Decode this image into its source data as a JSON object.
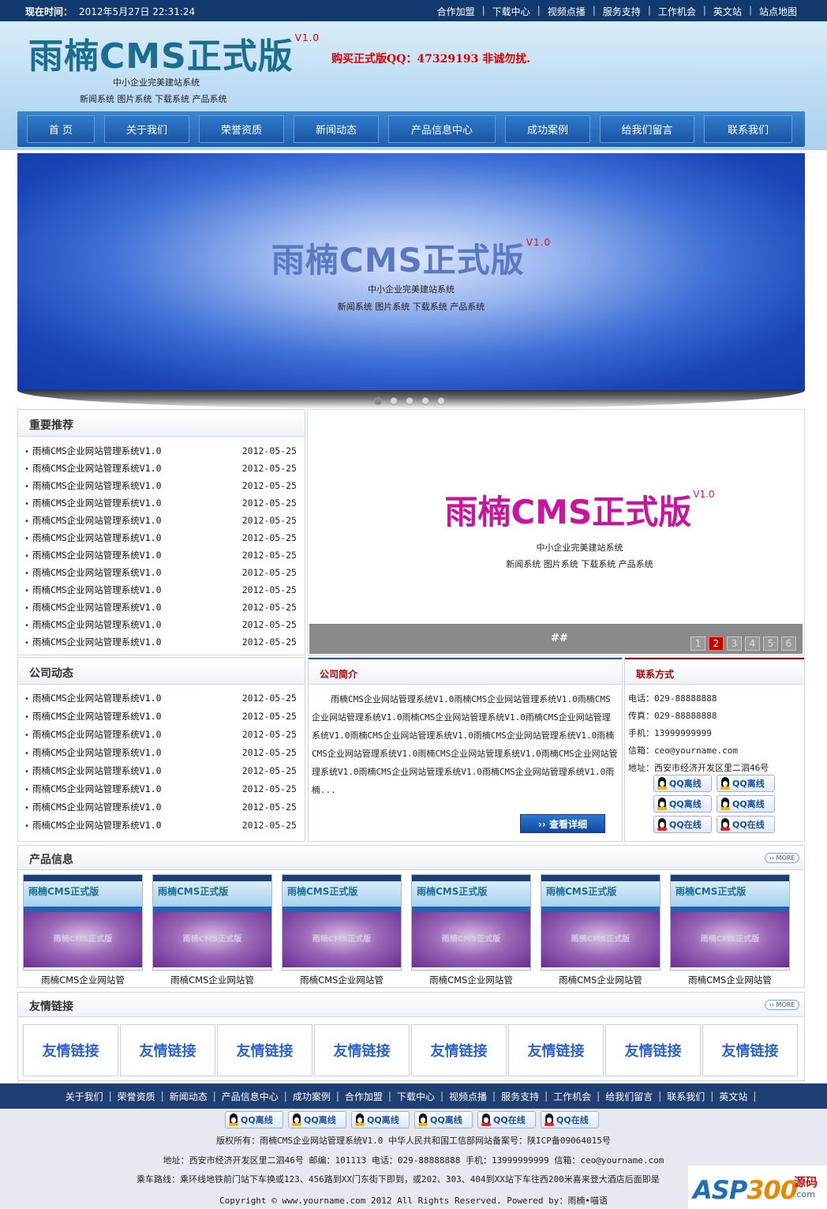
{
  "topbar": {
    "time_label": "现在时间：",
    "time_value": "2012年5月27日 22:31:24",
    "links": [
      "合作加盟",
      "下载中心",
      "视频点播",
      "服务支持",
      "工作机会",
      "英文站",
      "站点地图"
    ]
  },
  "header": {
    "logo_text": "雨楠CMS正式版",
    "logo_version": "V1.0",
    "subtitle1": "中小企业完美建站系统",
    "subtitle2": "新闻系统 图片系统 下载系统 产品系统",
    "buy_text": "购买正式版QQ：47329193 非诚勿扰."
  },
  "nav": {
    "items": [
      "首 页",
      "关于我们",
      "荣誉资质",
      "新闻动态",
      "产品信息中心",
      "成功案例",
      "给我们留言",
      "联系我们"
    ]
  },
  "banner": {
    "title": "雨楠CMS正式版",
    "version": "V1.0",
    "subtitle1": "中小企业完美建站系统",
    "subtitle2": "新闻系统 图片系统 下载系统 产品系统"
  },
  "recommend": {
    "title": "重要推荐",
    "items": [
      {
        "t": "雨楠CMS企业网站管理系统V1.0",
        "d": "2012-05-25"
      },
      {
        "t": "雨楠CMS企业网站管理系统V1.0",
        "d": "2012-05-25"
      },
      {
        "t": "雨楠CMS企业网站管理系统V1.0",
        "d": "2012-05-25"
      },
      {
        "t": "雨楠CMS企业网站管理系统V1.0",
        "d": "2012-05-25"
      },
      {
        "t": "雨楠CMS企业网站管理系统V1.0",
        "d": "2012-05-25"
      },
      {
        "t": "雨楠CMS企业网站管理系统V1.0",
        "d": "2012-05-25"
      },
      {
        "t": "雨楠CMS企业网站管理系统V1.0",
        "d": "2012-05-25"
      },
      {
        "t": "雨楠CMS企业网站管理系统V1.0",
        "d": "2012-05-25"
      },
      {
        "t": "雨楠CMS企业网站管理系统V1.0",
        "d": "2012-05-25"
      },
      {
        "t": "雨楠CMS企业网站管理系统V1.0",
        "d": "2012-05-25"
      },
      {
        "t": "雨楠CMS企业网站管理系统V1.0",
        "d": "2012-05-25"
      },
      {
        "t": "雨楠CMS企业网站管理系统V1.0",
        "d": "2012-05-25"
      }
    ]
  },
  "slideshow": {
    "title": "雨楠CMS正式版",
    "version": "V1.0",
    "subtitle1": "中小企业完美建站系统",
    "subtitle2": "新闻系统 图片系统 下载系统 产品系统",
    "caption": "##",
    "pages": [
      "1",
      "2",
      "3",
      "4",
      "5",
      "6"
    ],
    "active_page": "2"
  },
  "news": {
    "title": "公司动态",
    "items": [
      {
        "t": "雨楠CMS企业网站管理系统V1.0",
        "d": "2012-05-25"
      },
      {
        "t": "雨楠CMS企业网站管理系统V1.0",
        "d": "2012-05-25"
      },
      {
        "t": "雨楠CMS企业网站管理系统V1.0",
        "d": "2012-05-25"
      },
      {
        "t": "雨楠CMS企业网站管理系统V1.0",
        "d": "2012-05-25"
      },
      {
        "t": "雨楠CMS企业网站管理系统V1.0",
        "d": "2012-05-25"
      },
      {
        "t": "雨楠CMS企业网站管理系统V1.0",
        "d": "2012-05-25"
      },
      {
        "t": "雨楠CMS企业网站管理系统V1.0",
        "d": "2012-05-25"
      },
      {
        "t": "雨楠CMS企业网站管理系统V1.0",
        "d": "2012-05-25"
      }
    ]
  },
  "intro": {
    "title": "公司简介",
    "text": "雨楠CMS企业网站管理系统V1.0雨楠CMS企业网站管理系统V1.0雨楠CMS企业网站管理系统V1.0雨楠CMS企业网站管理系统V1.0雨楠CMS企业网站管理系统V1.0雨楠CMS企业网站管理系统V1.0雨楠CMS企业网站管理系统V1.0雨楠CMS企业网站管理系统V1.0雨楠CMS企业网站管理系统V1.0雨楠CMS企业网站管理系统V1.0雨楠CMS企业网站管理系统V1.0雨楠CMS企业网站管理系统V1.0雨楠...",
    "more_label": "›› 查看详细"
  },
  "contact": {
    "title": "联系方式",
    "rows": [
      "电话：029-88888888",
      "传真：029-88888888",
      "手机：13999999999",
      "信箱：ceo@yourname.com",
      "地址：西安市经济开发区里二泗46号"
    ],
    "qq_buttons": [
      "QQ离线",
      "QQ离线",
      "QQ离线",
      "QQ离线",
      "QQ在线",
      "QQ在线"
    ]
  },
  "products": {
    "title": "产品信息",
    "more": "›› MORE",
    "thumb_logo": "雨楠CMS正式版",
    "thumb_mid": "雨楠CMS正式版",
    "items": [
      "雨楠CMS企业网站管",
      "雨楠CMS企业网站管",
      "雨楠CMS企业网站管",
      "雨楠CMS企业网站管",
      "雨楠CMS企业网站管",
      "雨楠CMS企业网站管"
    ]
  },
  "links": {
    "title": "友情链接",
    "more": "›› MORE",
    "items": [
      "友情链接",
      "友情链接",
      "友情链接",
      "友情链接",
      "友情链接",
      "友情链接",
      "友情链接",
      "友情链接"
    ]
  },
  "footer": {
    "nav": [
      "关于我们",
      "荣誉资质",
      "新闻动态",
      "产品信息中心",
      "成功案例",
      "合作加盟",
      "下载中心",
      "视频点播",
      "服务支持",
      "工作机会",
      "给我们留言",
      "联系我们",
      "英文站"
    ],
    "qq_buttons": [
      "QQ离线",
      "QQ离线",
      "QQ离线",
      "QQ离线",
      "QQ在线",
      "QQ在线"
    ],
    "line1": "版权所有：雨楠CMS企业网站管理系统V1.0 中华人民共和国工信部网站备案号：陕ICP备09064015号",
    "line2": "地址：西安市经济开发区里二泗46号 邮编：101113 电话：029-88888888 手机：13999999999 信箱：ceo@yourname.com",
    "line3": "乘车路线：乘环线地铁前门站下车换或123、456路到XX门东街下即到，或202、303、404到XX站下车往西200米喜来登大酒店后面即是",
    "line4": "Copyright © www.yourname.com 2012 All Rights Reserved. Powered by：雨楠•喵语"
  },
  "watermark": {
    "brand_a": "ASP",
    "brand_b": "300",
    "brand_cn": "源码",
    "brand_dom": ".com"
  }
}
